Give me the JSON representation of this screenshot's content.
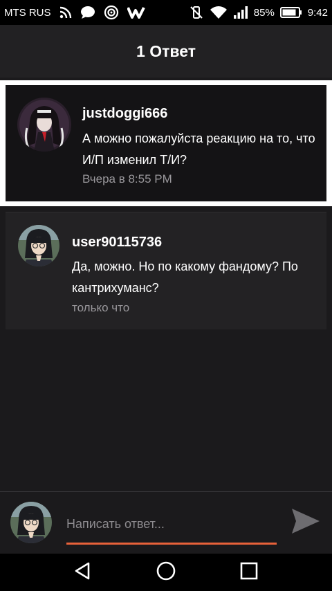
{
  "status_bar": {
    "carrier": "MTS RUS",
    "battery": "85%",
    "time": "9:42",
    "icons": [
      "rss-icon",
      "chat-bubble-icon",
      "target-icon",
      "w-app-icon",
      "vibrate-off-icon",
      "wifi-icon",
      "signal-icon",
      "battery-icon"
    ]
  },
  "header": {
    "title": "1 Ответ"
  },
  "parent_comment": {
    "username": "justdoggi666",
    "text": "А можно пожалуйста реакцию на то, что И/П изменил Т/И?",
    "timestamp": "Вчера в 8:55 PM"
  },
  "reply": {
    "username": "user90115736",
    "text": "Да, можно. Но по какому фандому? По кантрихуманс?",
    "timestamp": "только что"
  },
  "composer": {
    "placeholder": "Написать ответ..."
  },
  "nav": {
    "icons": [
      "back-icon",
      "home-icon",
      "recents-icon"
    ]
  },
  "colors": {
    "accent": "#e8623a",
    "background": "#1b1a1c",
    "card": "#232224"
  }
}
